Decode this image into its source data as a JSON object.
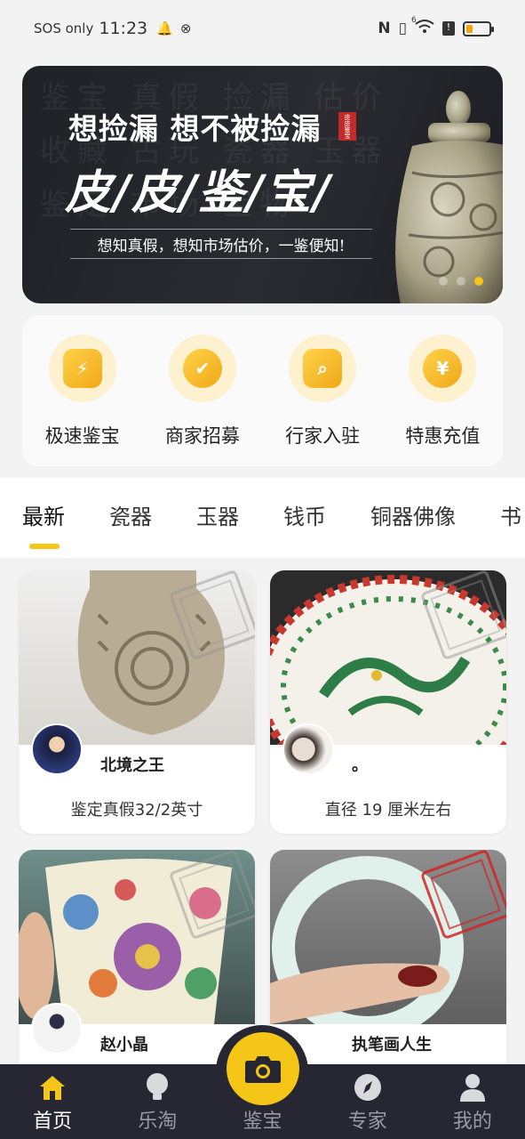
{
  "status_bar": {
    "carrier": "SOS only",
    "time": "11:23",
    "nfc": "N",
    "signal": "6"
  },
  "banner": {
    "slogan": "想捡漏 想不被捡漏",
    "seal_text": "皮皮鉴宝",
    "brand": "皮/皮/鉴/宝/",
    "subtitle": "想知真假，想知市场估价，一鉴便知!",
    "bg_calligraphy": "鉴宝 真假 捡漏 估价 收藏 古玩 瓷器 玉器 鉴定 市场 宝物",
    "slide_count": 3,
    "active_slide": 3
  },
  "quick_actions": [
    {
      "label": "极速鉴宝",
      "icon": "fast-appraisal-icon",
      "glyph": "⚡"
    },
    {
      "label": "商家招募",
      "icon": "merchant-recruit-icon",
      "glyph": "✔"
    },
    {
      "label": "行家入驻",
      "icon": "expert-join-icon",
      "glyph": "⌕"
    },
    {
      "label": "特惠充值",
      "icon": "recharge-icon",
      "glyph": "¥"
    }
  ],
  "tabs": [
    {
      "label": "最新",
      "active": true
    },
    {
      "label": "瓷器",
      "active": false
    },
    {
      "label": "玉器",
      "active": false
    },
    {
      "label": "钱币",
      "active": false
    },
    {
      "label": "铜器佛像",
      "active": false
    },
    {
      "label": "书",
      "active": false
    }
  ],
  "feed": [
    {
      "user": "北境之王",
      "desc": "鉴定真假32/2英寸",
      "subject": "jade-carving",
      "stamp": "gray"
    },
    {
      "user": "。",
      "desc": "直径 19 厘米左右",
      "subject": "dragon-plate",
      "stamp": "gray"
    },
    {
      "user": "赵小晶",
      "desc": "",
      "subject": "enamel-cup",
      "stamp": "gray"
    },
    {
      "user": "执笔画人生",
      "desc": "",
      "subject": "jade-bangle",
      "stamp": "red"
    }
  ],
  "bottom_nav": [
    {
      "label": "首页",
      "icon": "home-icon",
      "active": true
    },
    {
      "label": "乐淘",
      "icon": "lightbulb-icon",
      "active": false
    },
    {
      "label": "鉴宝",
      "icon": "camera-icon",
      "active": false
    },
    {
      "label": "专家",
      "icon": "compass-icon",
      "active": false
    },
    {
      "label": "我的",
      "icon": "profile-icon",
      "active": false
    }
  ],
  "colors": {
    "accent": "#f5c518",
    "nav_bg": "#262733",
    "banner_bg": "#23242a",
    "page_bg": "#f3f3f3"
  }
}
